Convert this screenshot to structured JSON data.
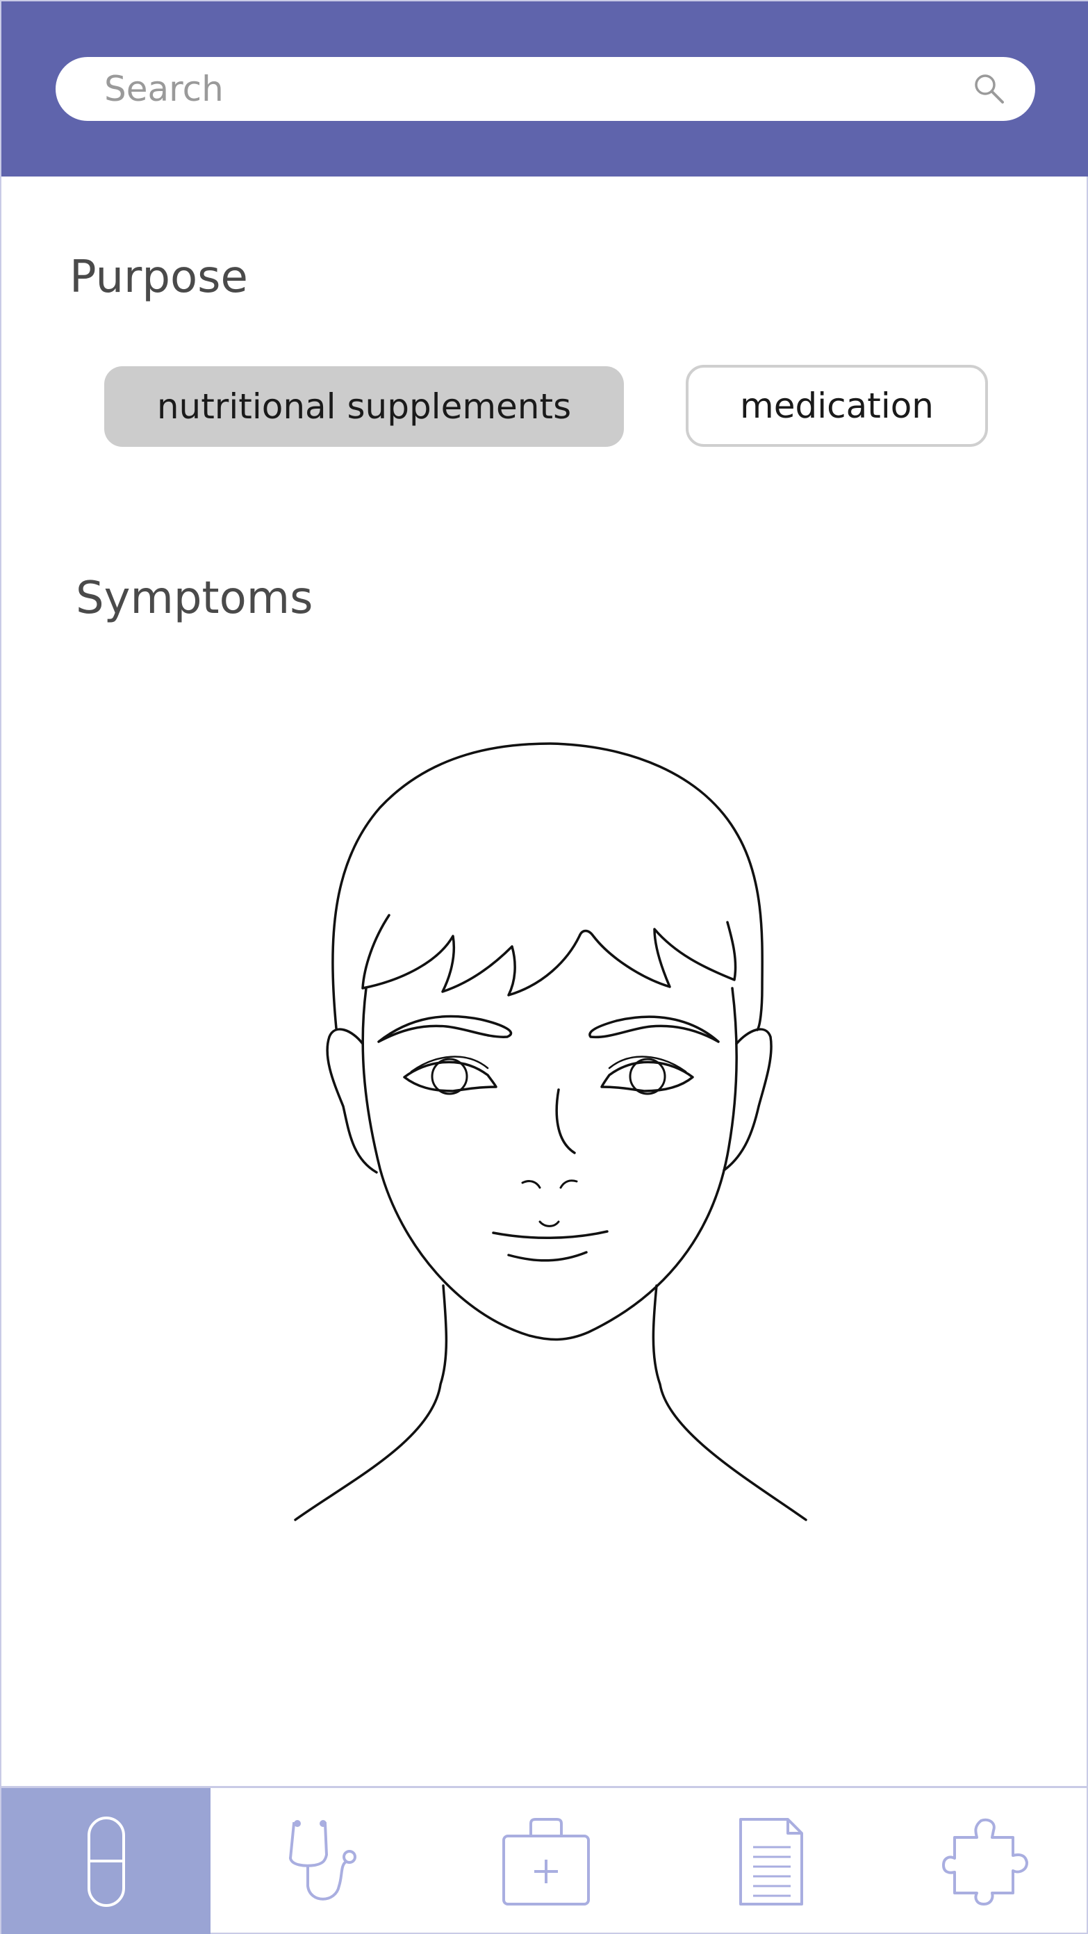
{
  "search": {
    "placeholder": "Search",
    "value": ""
  },
  "purpose": {
    "title": "Purpose",
    "options": [
      {
        "label": "nutritional supplements",
        "selected": true
      },
      {
        "label": "medication",
        "selected": false
      }
    ]
  },
  "symptoms": {
    "title": "Symptoms",
    "figure_icon": "face-diagram"
  },
  "bottom_nav": {
    "items": [
      {
        "icon": "pill-icon",
        "active": true
      },
      {
        "icon": "stethoscope-icon",
        "active": false
      },
      {
        "icon": "first-aid-kit-icon",
        "active": false
      },
      {
        "icon": "document-icon",
        "active": false
      },
      {
        "icon": "puzzle-icon",
        "active": false
      }
    ]
  },
  "colors": {
    "header": "#5f64ac",
    "nav_active": "#9aa4d4",
    "nav_icon": "#a9aee0",
    "pill_selected": "#cccccc",
    "frame_border": "#c9cbe6"
  }
}
